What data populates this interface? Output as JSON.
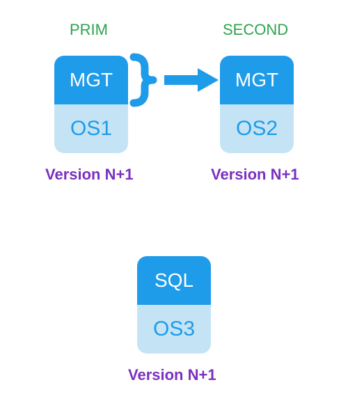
{
  "roles": {
    "primary": "PRIM",
    "secondary": "SECOND"
  },
  "boxes": {
    "primary": {
      "top": "MGT",
      "bottom": "OS1"
    },
    "secondary": {
      "top": "MGT",
      "bottom": "OS2"
    },
    "sql": {
      "top": "SQL",
      "bottom": "OS3"
    }
  },
  "versions": {
    "primary": "Version N+1",
    "secondary": "Version N+1",
    "sql": "Version N+1"
  },
  "colors": {
    "role_label": "#2da44e",
    "version_label": "#7b2fbf",
    "box_top_bg": "#1e9be9",
    "box_bottom_bg": "#c4e4f5",
    "box_bottom_text": "#1e9be9",
    "arrow": "#1e9be9"
  }
}
